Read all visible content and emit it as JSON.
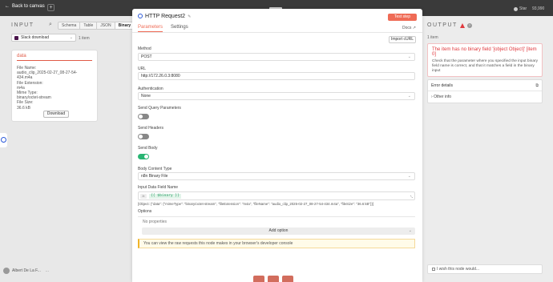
{
  "topbar": {
    "back_label": "Back to canvas",
    "plus": "+",
    "handle": "::::",
    "github": "Star",
    "stars": "93,990"
  },
  "input_panel": {
    "title": "INPUT",
    "tabs": [
      "Schema",
      "Table",
      "JSON",
      "Binary"
    ],
    "active_tab": "Binary",
    "source_select": "Slack download",
    "item_count": "1 item",
    "card": {
      "title": "data",
      "lines": [
        "File Name:",
        "audio_clip_2025-02-27_08-27-54-434.m4a",
        "File Extension:",
        "m4a",
        "Mime Type:",
        "binary/octet-stream",
        "File Size:",
        "36.6 kB"
      ],
      "download_label": "Download"
    }
  },
  "user": {
    "name": "Albert De La F...",
    "menu": "..."
  },
  "node": {
    "title": "HTTP Request2",
    "test_step": "Test step",
    "tabs": [
      "Parameters",
      "Settings"
    ],
    "docs": "Docs",
    "import_curl": "Import cURL",
    "method_label": "Method",
    "method_value": "POST",
    "url_label": "URL",
    "url_value": "http://172.26.0.3:8080",
    "auth_label": "Authentication",
    "auth_value": "None",
    "query_label": "Send Query Parameters",
    "query_on": false,
    "headers_label": "Send Headers",
    "headers_on": false,
    "body_label": "Send Body",
    "body_on": true,
    "content_type_label": "Body Content Type",
    "content_type_value": "n8n Binary File",
    "input_field_label": "Input Data Field Name",
    "input_field_value": "{{ $binary }}",
    "fx": "fx",
    "result": "[Object: {\"data\": {\"mimeType\": \"binary/octet-stream\", \"fileExtension\": \"m4a\", \"fileName\": \"audio_clip_2025-02-27_08-27-54-434.m4a\", \"fileSize\": \"36.6 kB\"}}]",
    "options_label": "Options",
    "no_props": "No properties",
    "add_option": "Add option",
    "notice": "You can view the raw requests this node makes in your browser's developer console"
  },
  "output_panel": {
    "title": "OUTPUT",
    "item_count": "1 item",
    "error_title": "The item has no binary field '[object Object]' [item 0]",
    "error_desc": "Check that the parameter where you specified the input binary field name is correct, and that it matches a field in the binary input",
    "details_label": "Error details",
    "other_info": "Other info",
    "bottom_hint": "I wish this node would..."
  },
  "colors": {
    "accent": "#ef6b56",
    "success": "#29b573",
    "error": "#e0393e",
    "topbar": "#3a3a3a"
  }
}
